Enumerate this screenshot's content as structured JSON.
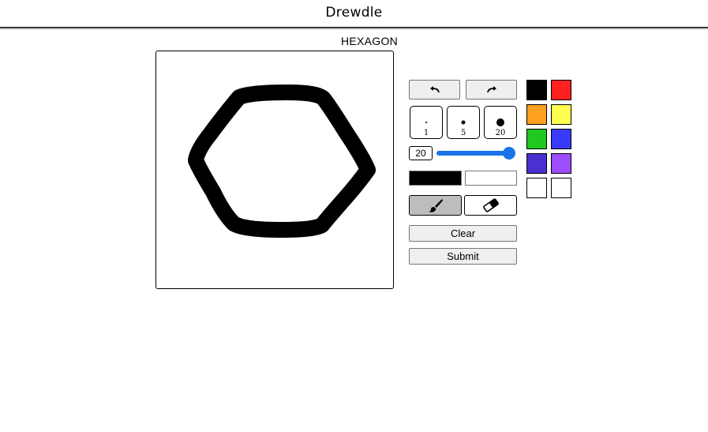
{
  "app": {
    "title": "Drewdle"
  },
  "prompt": {
    "word": "HEXAGON"
  },
  "history": {
    "undo_icon": "undo-arrow-icon",
    "redo_icon": "redo-arrow-icon"
  },
  "brush_sizes": [
    {
      "label": "1",
      "value": 1
    },
    {
      "label": "5",
      "value": 5
    },
    {
      "label": "20",
      "value": 20
    }
  ],
  "size_control": {
    "value": "20",
    "min": 1,
    "max": 20
  },
  "colors": {
    "primary": "#000000",
    "secondary": "#ffffff",
    "palette": [
      "#000000",
      "#ff2020",
      "#ffa020",
      "#ffff50",
      "#20c820",
      "#3a3aff",
      "#4b2fd0",
      "#9b4dff",
      "#ffffff",
      "#ffffff"
    ]
  },
  "tools": {
    "brush_icon": "paintbrush-icon",
    "eraser_icon": "eraser-icon",
    "active": "brush"
  },
  "actions": {
    "clear_label": "Clear",
    "submit_label": "Submit"
  }
}
